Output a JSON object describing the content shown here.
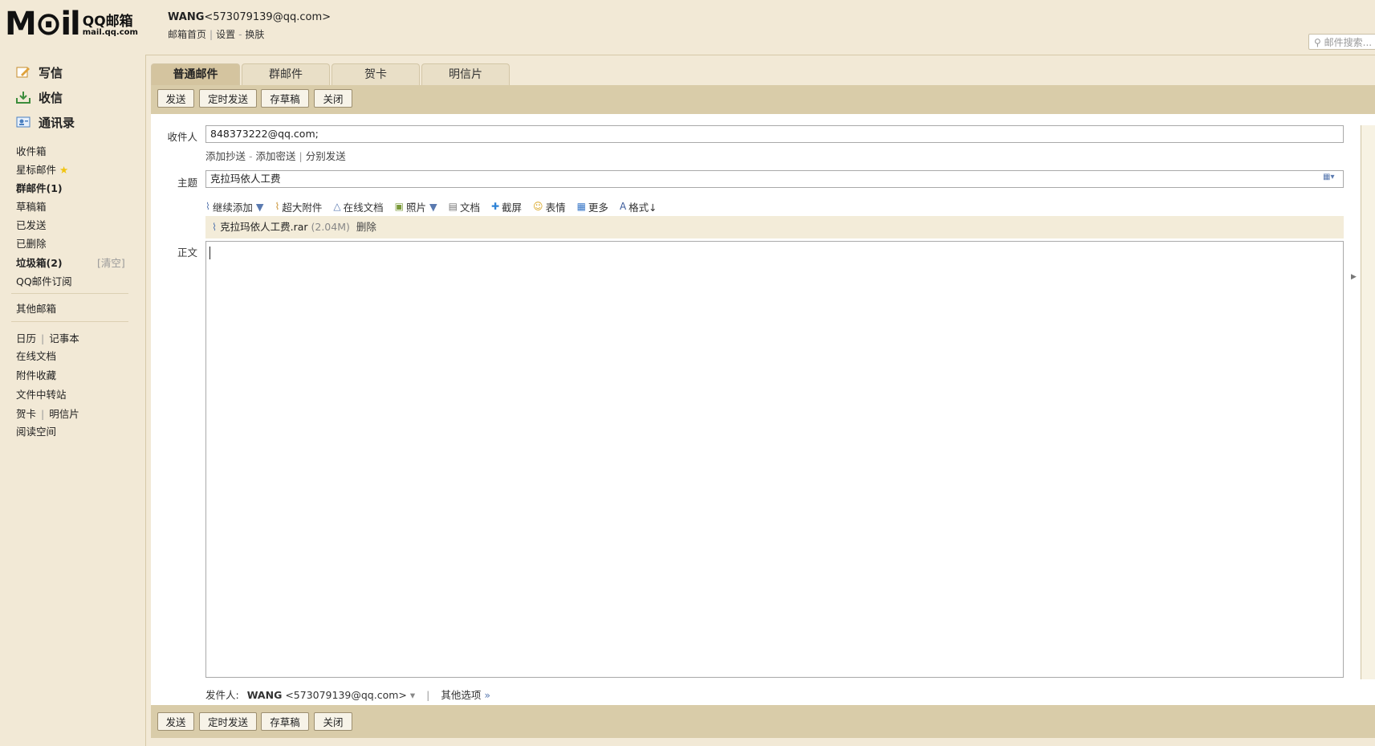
{
  "header": {
    "logo_main": "M⊙il",
    "logo_brand": "QQ邮箱",
    "logo_domain": "mail.qq.com",
    "user_name": "WANG",
    "user_email": "<573079139@qq.com>",
    "links": [
      "邮箱首页",
      "设置",
      "换肤"
    ],
    "search_placeholder": "邮件搜索..."
  },
  "sidebar": {
    "primary": [
      {
        "label": "写信",
        "icon": "write-icon"
      },
      {
        "label": "收信",
        "icon": "inbox-download-icon"
      },
      {
        "label": "通讯录",
        "icon": "contacts-icon"
      }
    ],
    "folders": [
      {
        "label": "收件箱"
      },
      {
        "label": "星标邮件"
      },
      {
        "label": "群邮件(1)"
      },
      {
        "label": "草稿箱"
      },
      {
        "label": "已发送"
      },
      {
        "label": "已删除"
      },
      {
        "label": "垃圾箱(2)",
        "action": "[清空]"
      },
      {
        "label": "QQ邮件订阅"
      }
    ],
    "other_mailbox": "其他邮箱",
    "tools": {
      "calendar": "日历",
      "notebook": "记事本",
      "online_docs": "在线文档",
      "attachments": "附件收藏",
      "file_transfer": "文件中转站",
      "greeting_card": "贺卡",
      "postcard": "明信片",
      "reading": "阅读空间"
    }
  },
  "tabs": [
    "普通邮件",
    "群邮件",
    "贺卡",
    "明信片"
  ],
  "toolbar": {
    "send": "发送",
    "scheduled_send": "定时发送",
    "save_draft": "存草稿",
    "close": "关闭"
  },
  "compose": {
    "to_label": "收件人",
    "to_value": "848373222@qq.com;",
    "cc_link": "添加抄送",
    "bcc_link": "添加密送",
    "separate_link": "分别发送",
    "subject_label": "主题",
    "subject_value": "克拉玛依人工费",
    "body_label": "正文",
    "attach_tools": {
      "continue_add": "继续添加",
      "large_attach": "超大附件",
      "online_doc": "在线文档",
      "photo": "照片",
      "document": "文档",
      "screenshot": "截屏",
      "emoji": "表情",
      "more": "更多",
      "format": "格式↓"
    },
    "attachment": {
      "name": "克拉玛依人工费.rar",
      "size": "(2.04M)",
      "delete": "删除"
    },
    "sender_label": "发件人:",
    "sender_name": "WANG",
    "sender_email": "<573079139@qq.com>",
    "other_options": "其他选项"
  }
}
